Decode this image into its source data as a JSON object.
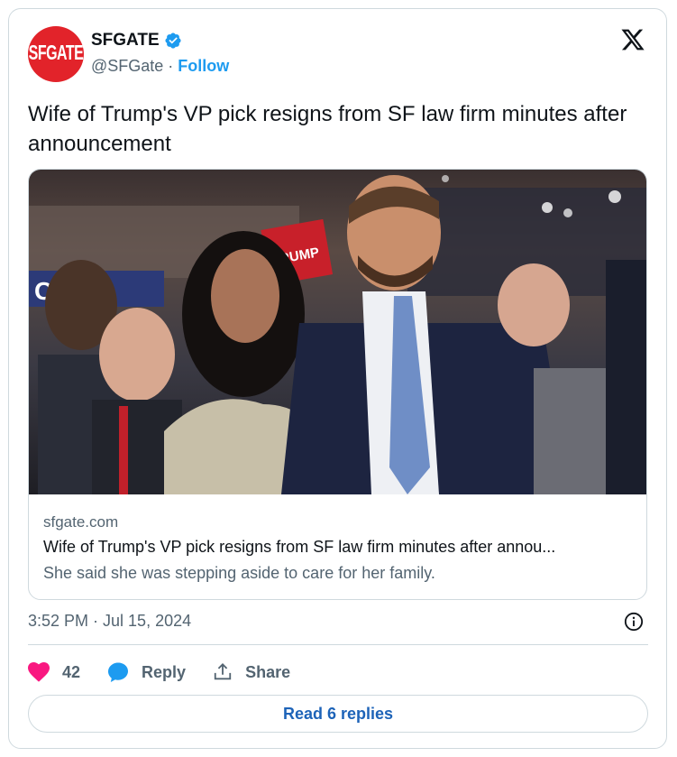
{
  "author": {
    "avatar_text": "SFGATE",
    "name": "SFGATE",
    "handle": "@SFGate",
    "separator": "·",
    "follow_label": "Follow"
  },
  "tweet": {
    "text": "Wife of Trump's VP pick resigns from SF law firm minutes after announcement",
    "timestamp": "3:52 PM · Jul 15, 2024"
  },
  "link_card": {
    "domain": "sfgate.com",
    "title": "Wife of Trump's VP pick resigns from SF law firm minutes after annou...",
    "description": "She said she was stepping aside to care for her family.",
    "photo_sign_text": "TRUMP",
    "photo_banner_text": "CI   EA"
  },
  "actions": {
    "like_count": "42",
    "reply_label": "Reply",
    "share_label": "Share"
  },
  "read_replies_label": "Read 6 replies",
  "colors": {
    "brand_red": "#e2232a",
    "link_blue": "#1d9bf0",
    "like_pink": "#f91880",
    "reply_blue": "#1d9bf0"
  }
}
